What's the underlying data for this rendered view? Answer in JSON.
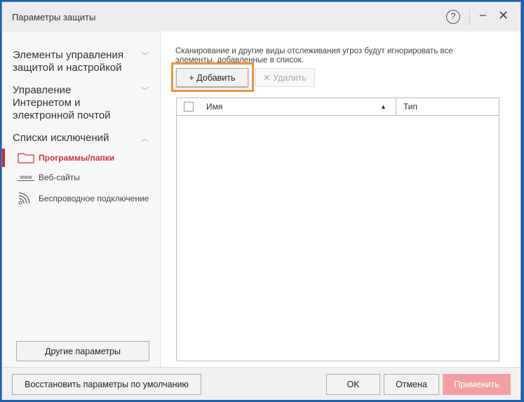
{
  "window": {
    "title": "Параметры защиты",
    "help": "?",
    "minimize": "−",
    "close": "✕"
  },
  "sidebar": {
    "groups": [
      {
        "label": "Элементы управления защитой и настройкой"
      },
      {
        "label": "Управление Интернетом и электронной почтой"
      },
      {
        "label": "Списки исключений"
      }
    ],
    "items": [
      {
        "label": "Программы/папки"
      },
      {
        "label": "Веб-сайты"
      },
      {
        "label": "Беспроводное подключение"
      }
    ],
    "www": "www",
    "other_button": "Другие параметры"
  },
  "main": {
    "description": "Сканирование и другие виды отслеживания угроз будут игнорировать все элементы, добавленные в список.",
    "add_button": "+ Добавить",
    "delete_button": "✕ Удалить",
    "columns": {
      "name": "Имя",
      "type": "Тип"
    },
    "sort_indicator": "▲"
  },
  "footer": {
    "restore": "Восстановить параметры по умолчанию",
    "ok": "OK",
    "cancel": "Отмена",
    "apply": "Применить"
  },
  "colors": {
    "accent": "#d8202c",
    "highlight": "#f0923a",
    "apply_bg": "#f0a0a4"
  }
}
